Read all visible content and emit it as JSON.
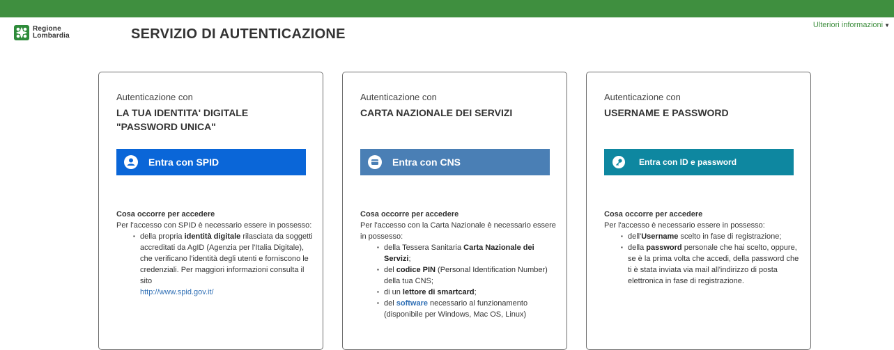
{
  "header": {
    "logo_line1": "Regione",
    "logo_line2": "Lombardia",
    "title": "SERVIZIO DI AUTENTICAZIONE",
    "more_info": "Ulteriori informazioni"
  },
  "icons": {
    "logo": "regione-lombardia-rosa-camuna-icon",
    "spid": "user-icon",
    "cns": "card-icon",
    "pwd": "key-icon",
    "caret": "caret-down-icon"
  },
  "colors": {
    "topbar": "#3f8f3f",
    "spid_button": "#0a66d8",
    "cns_button": "#4a7fb5",
    "pwd_button": "#0e87a0"
  },
  "cards": [
    {
      "subtitle": "Autenticazione con",
      "title": "LA TUA IDENTITA' DIGITALE \"PASSWORD UNICA\"",
      "button": "Entra con SPID",
      "req_title": "Cosa occorre per accedere",
      "req_intro": "Per l'accesso con SPID è necessario essere in possesso:",
      "items": [
        {
          "a": "della propria ",
          "b": "identità digitale",
          "c": " rilasciata da soggetti accreditati da AgID (Agenzia per l'Italia Digitale), che verificano l'identità degli utenti e forniscono le credenziali. Per maggiori informazioni consulta il sito ",
          "link": "http://www.spid.gov.it/"
        }
      ]
    },
    {
      "subtitle": "Autenticazione con",
      "title": "CARTA NAZIONALE DEI SERVIZI",
      "button": "Entra con CNS",
      "req_title": "Cosa occorre per accedere",
      "req_intro": "Per l'accesso con la Carta Nazionale è necessario essere in possesso:",
      "items": [
        {
          "a": "della Tessera Sanitaria ",
          "b": "Carta Nazionale dei Servizi",
          "c": ";"
        },
        {
          "a": "del ",
          "b": "codice PIN",
          "c": " (Personal Identification Number) della tua CNS;"
        },
        {
          "a": "di un ",
          "b": "lettore di smartcard",
          "c": ";"
        },
        {
          "a": "del ",
          "link": "software",
          "c": " necessario al funzionamento (disponibile per Windows, Mac OS, Linux)"
        }
      ]
    },
    {
      "subtitle": "Autenticazione con",
      "title": "USERNAME E PASSWORD",
      "button": "Entra con ID e password",
      "req_title": "Cosa occorre per accedere",
      "req_intro": "Per l'accesso è necessario essere in possesso:",
      "items": [
        {
          "a": "dell'",
          "b": "Username",
          "c": " scelto in fase di registrazione;"
        },
        {
          "a": "della ",
          "b": "password",
          "c": " personale che hai scelto, oppure, se è la prima volta che accedi, della password che ti è stata inviata via mail all'indirizzo di posta elettronica in fase di registrazione."
        }
      ]
    }
  ]
}
